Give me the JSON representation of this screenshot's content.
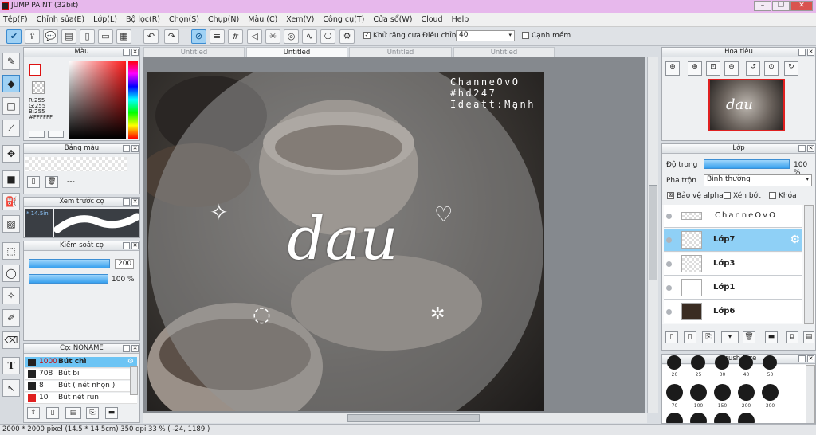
{
  "window": {
    "title": "JUMP PAINT (32bit)"
  },
  "menu": [
    "Tệp(F)",
    "Chỉnh sửa(E)",
    "Lớp(L)",
    "Bộ lọc(R)",
    "Chọn(S)",
    "Chụp(N)",
    "Màu (C)",
    "Xem(V)",
    "Công cụ(T)",
    "Cửa sổ(W)",
    "Cloud",
    "Help"
  ],
  "toolbar": {
    "antialias_label": "Khử răng cưa",
    "adjust_label": "Điều chỉnh",
    "adjust_value": "40",
    "soft_edge_label": "Cạnh mềm"
  },
  "doc_tabs": [
    "Untitled",
    "Untitled",
    "Untitled",
    "Untitled"
  ],
  "color_panel": {
    "title": "Màu",
    "r": "R:255",
    "g": "G:255",
    "b": "B:255",
    "hex": "#FFFFFF"
  },
  "palette_panel": {
    "title": "Bảng màu",
    "dash": "---"
  },
  "brush_preview": {
    "title": "Xem trước cọ",
    "size": "* 14.5in"
  },
  "brush_control": {
    "title": "Kiểm soát cọ",
    "size_value": "200",
    "opacity_value": "100 %"
  },
  "brush_list": {
    "title": "Cọ: NONAME",
    "items": [
      {
        "size": "1000",
        "name": "Bút chì",
        "swatch": "#222222"
      },
      {
        "size": "708",
        "name": "Bút bi",
        "swatch": "#222222"
      },
      {
        "size": "8",
        "name": "Bút ( nét nhọn )",
        "swatch": "#222222"
      },
      {
        "size": "10",
        "name": "Bút nét run",
        "swatch": "#e02020"
      }
    ]
  },
  "canvas": {
    "credit_lines": [
      "ChanneOvO",
      "#hd247",
      "Ideatt:Mạnh"
    ],
    "word": "dau"
  },
  "navigator": {
    "title": "Hoa tiêu"
  },
  "layers": {
    "title": "Lớp",
    "opacity_label": "Độ trong",
    "opacity_value": "100 %",
    "opacity_fraction": 1.0,
    "blend_label": "Pha trộn",
    "blend_value": "Bình thường",
    "protect_alpha": "Bảo vệ alpha",
    "clip": "Xén bớt",
    "lock": "Khóa",
    "items": [
      {
        "name": "ChanneOvO"
      },
      {
        "name": "Lớp7"
      },
      {
        "name": "Lớp3"
      },
      {
        "name": "Lớp1"
      },
      {
        "name": "Lớp6"
      }
    ],
    "selected": "Lớp7"
  },
  "brush_size": {
    "title": "Brush Size",
    "row1": [
      "20",
      "25",
      "30",
      "40",
      "50"
    ],
    "row2": [
      "70",
      "100",
      "150",
      "200",
      "300"
    ]
  },
  "status": {
    "text": "2000 * 2000 pixel  (14.5 * 14.5cm)  350 dpi  33 %  ( -24, 1189 )"
  }
}
